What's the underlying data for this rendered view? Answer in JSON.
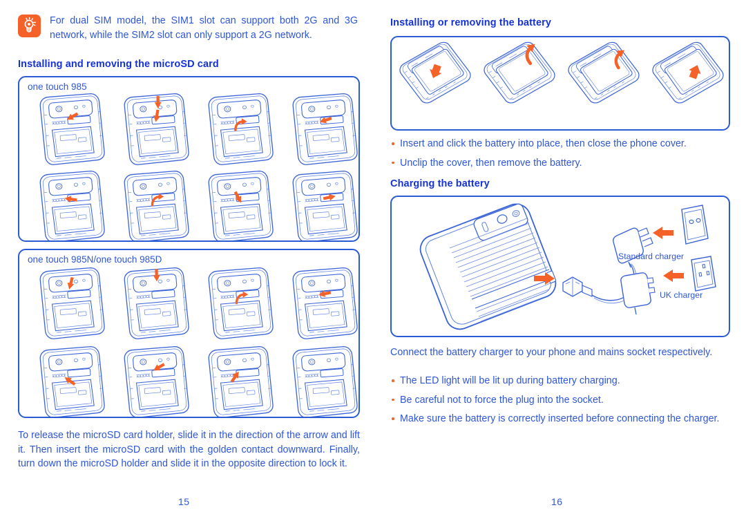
{
  "colors": {
    "heading_blue": "#1533d4",
    "body_blue": "#2e56d8",
    "accent_orange": "#f4622a",
    "frame_blue": "#2a5bd7",
    "line_blue": "#3a63d8"
  },
  "left_page": {
    "page_number": "15",
    "tip": {
      "icon": "lightbulb-tip-icon",
      "text": "For dual SIM model, the SIM1 slot can support both 2G and 3G network, while the SIM2 slot can only support a 2G network."
    },
    "heading": "Installing and removing the microSD card",
    "figure_one": {
      "label": "one touch 985",
      "rows": 2,
      "cols": 4,
      "alt": "eight phone back-cover diagrams showing microSD holder slide, lift, insert and lock steps"
    },
    "figure_two": {
      "label": "one touch 985N/one touch 985D",
      "rows": 2,
      "cols": 4,
      "alt": "eight phone back-cover diagrams for 985N and 985D variants"
    },
    "body": "To release the microSD card holder, slide it in the direction of the arrow and lift it. Then insert the microSD card with the golden contact downward. Finally, turn down the microSD holder and slide it in the opposite direction to lock it."
  },
  "right_page": {
    "page_number": "16",
    "heading_battery": "Installing or removing the battery",
    "figure_battery": {
      "alt": "four phone diagrams showing battery insertion and removal"
    },
    "bullets_battery": [
      "Insert and click the battery into place, then close the phone cover.",
      "Unclip the cover, then remove the battery."
    ],
    "heading_charging": "Charging the battery",
    "figure_charging": {
      "alt": "phone connected to charger with mains sockets",
      "label_standard": "Standard charger",
      "label_uk": "UK charger"
    },
    "body_charging": "Connect the battery charger to your phone and mains socket respectively.",
    "bullets_charging": [
      "The LED light will be lit up during battery charging.",
      "Be careful not to force the plug into the socket.",
      "Make sure the battery is correctly inserted before connecting the charger."
    ]
  }
}
